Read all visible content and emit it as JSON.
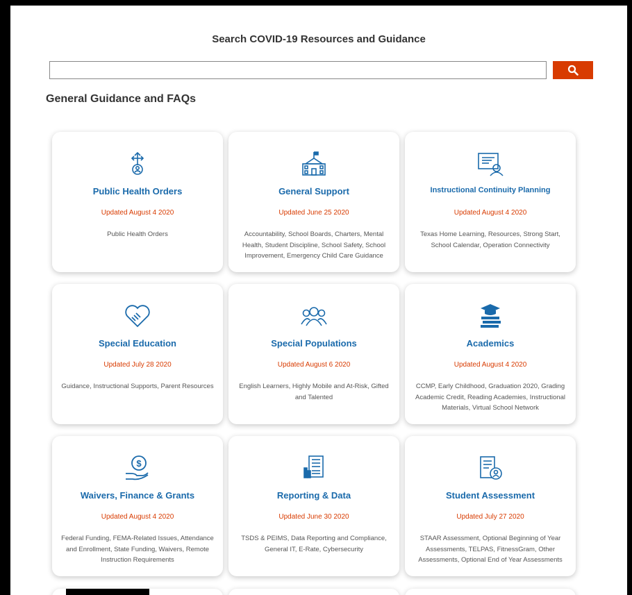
{
  "search": {
    "title": "Search COVID-19 Resources and Guidance",
    "placeholder": "",
    "value": "",
    "button_icon": "search-icon",
    "accent": "#d83b01"
  },
  "section": {
    "title": "General Guidance and FAQs"
  },
  "colors": {
    "title": "#1a6aab",
    "updated": "#d83b01"
  },
  "cards": [
    {
      "icon": "public-health-icon",
      "title": "Public Health Orders",
      "updated": "Updated August 4 2020",
      "desc": "Public Health Orders"
    },
    {
      "icon": "school-building-icon",
      "title": "General Support",
      "updated": "Updated June 25 2020",
      "desc": "Accountability, School Boards, Charters, Mental Health, Student Discipline, School Safety, School Improvement, Emergency Child Care Guidance"
    },
    {
      "icon": "instructional-planning-icon",
      "title": "Instructional Continuity Planning",
      "updated": "Updated August 4 2020",
      "desc": "Texas Home Learning, Resources, Strong Start, School Calendar, Operation Connectivity"
    },
    {
      "icon": "handshake-heart-icon",
      "title": "Special Education",
      "updated": "Updated July 28 2020",
      "desc": "Guidance, Instructional Supports, Parent Resources"
    },
    {
      "icon": "people-group-icon",
      "title": "Special Populations",
      "updated": "Updated August 6 2020",
      "desc": "English Learners, Highly Mobile and At-Risk, Gifted and Talented"
    },
    {
      "icon": "books-graduation-cap-icon",
      "title": "Academics",
      "updated": "Updated August 4 2020",
      "desc": "CCMP, Early Childhood, Graduation 2020, Grading Academic Credit, Reading Academies, Instructional Materials, Virtual School Network"
    },
    {
      "icon": "money-hand-icon",
      "title": "Waivers, Finance & Grants",
      "updated": "Updated August 4 2020",
      "desc": "Federal Funding, FEMA-Related Issues, Attendance and Enrollment, State Funding, Waivers, Remote Instruction Requirements"
    },
    {
      "icon": "data-report-icon",
      "title": "Reporting & Data",
      "updated": "Updated June 30 2020",
      "desc": "TSDS & PEIMS, Data Reporting and Compliance, General IT, E-Rate, Cybersecurity"
    },
    {
      "icon": "assessment-clipboard-icon",
      "title": "Student Assessment",
      "updated": "Updated July 27 2020",
      "desc": "STAAR Assessment, Optional Beginning of Year Assessments, TELPAS, FitnessGram, Other Assessments, Optional End of Year Assessments"
    }
  ]
}
